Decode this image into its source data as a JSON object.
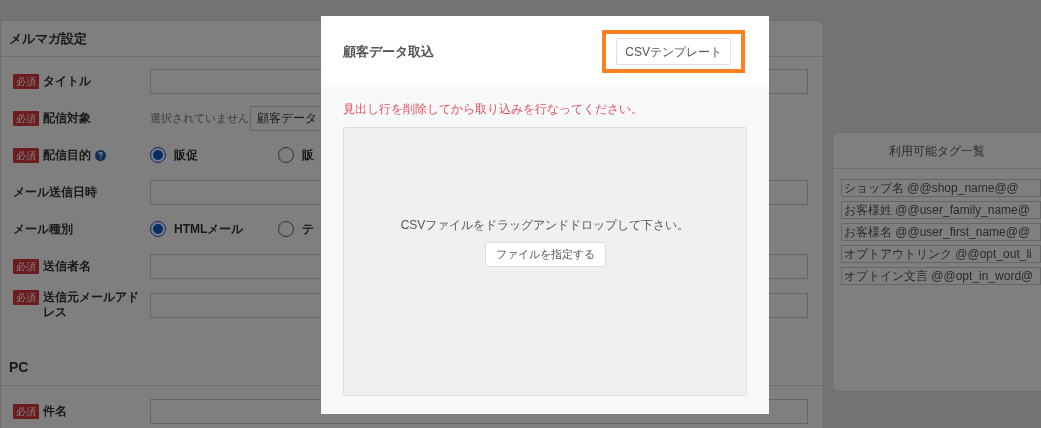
{
  "form": {
    "title": "メルマガ設定",
    "rows": [
      {
        "kind": "input",
        "label": "タイトル",
        "required": true
      },
      {
        "kind": "target",
        "label": "配信対象",
        "required": true,
        "status": "選択されていません",
        "button": "顧客データ"
      },
      {
        "kind": "radio",
        "label": "配信目的",
        "required": true,
        "help": true,
        "options": [
          {
            "label": "販促",
            "selected": true
          },
          {
            "label": "販",
            "selected": false
          }
        ]
      },
      {
        "kind": "input",
        "label": "メール送信日時",
        "required": false
      },
      {
        "kind": "radio",
        "label": "メール種別",
        "required": false,
        "options": [
          {
            "label": "HTMLメール",
            "selected": true
          },
          {
            "label": "テ",
            "selected": false
          }
        ]
      },
      {
        "kind": "input",
        "label": "送信者名",
        "required": true
      },
      {
        "kind": "input",
        "label": "送信元メールアドレス",
        "required": true
      }
    ],
    "required_badges": [
      "必須",
      "必須",
      "必須",
      "必須",
      "必須",
      "必須"
    ],
    "section": {
      "title": "PC",
      "rows": [
        {
          "kind": "input",
          "label": "件名",
          "required": true
        }
      ]
    }
  },
  "tags": {
    "title": "利用可能タグ一覧",
    "items": [
      "ショップ名 @@shop_name@@",
      "お客様姓 @@user_family_name@",
      "お客様名 @@user_first_name@@",
      "オプトアウトリンク @@opt_out_li",
      "オプトイン文言 @@opt_in_word@"
    ]
  },
  "modal": {
    "title": "顧客データ取込",
    "template_button": {
      "label": "CSVテンプレート",
      "highlighted": true
    },
    "notice": "見出し行を削除してから取り込みを行なってください。",
    "dropzone": {
      "text": "CSVファイルをドラッグアンドドロップして下さい。",
      "button": "ファイルを指定する"
    }
  }
}
